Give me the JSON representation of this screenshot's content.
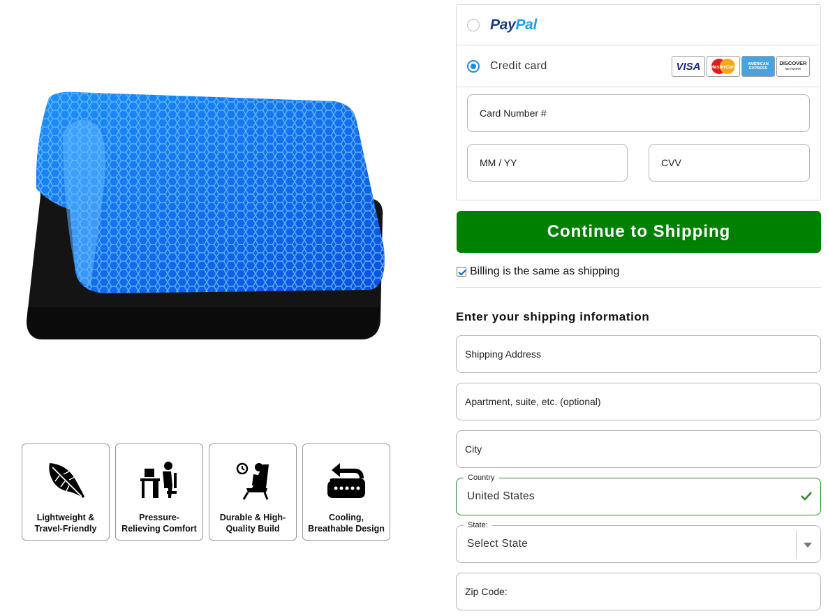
{
  "product": {
    "image_alt": "blue honeycomb gel seat cushion on black foam base",
    "features": [
      {
        "icon": "feather-icon",
        "label": "Lightweight &\nTravel-Friendly"
      },
      {
        "icon": "desk-worker-icon",
        "label": "Pressure-\nRelieving Comfort"
      },
      {
        "icon": "seated-person-clock-icon",
        "label": "Durable & High-\nQuality Build"
      },
      {
        "icon": "airflow-cushion-icon",
        "label": "Cooling,\nBreathable Design"
      }
    ]
  },
  "payment": {
    "paypal": {
      "logo_part1": "Pay",
      "logo_part2": "Pal",
      "selected": false
    },
    "credit_card": {
      "label": "Credit card",
      "selected": true,
      "logos": [
        "VISA",
        "MasterCard",
        "AMERICAN EXPRESS",
        "DISCOVER"
      ],
      "discover_sub": "NETWORK",
      "card_number_placeholder": "Card Number #",
      "expiry_placeholder": "MM / YY",
      "cvv_placeholder": "CVV"
    }
  },
  "actions": {
    "continue_label": "Continue to Shipping"
  },
  "billing": {
    "same_as_shipping_label": "Billing is the same as shipping",
    "checked": true
  },
  "shipping": {
    "title": "Enter your shipping information",
    "address_placeholder": "Shipping Address",
    "apartment_placeholder": "Apartment, suite, etc. (optional)",
    "city_placeholder": "City",
    "country_label": "Country",
    "country_value": "United States",
    "state_label": "State:",
    "state_value": "Select State",
    "zip_placeholder": "Zip Code:"
  },
  "colors": {
    "accent_green": "#008000",
    "radio_blue": "#1e8ae6",
    "valid_green": "#2e8b2e"
  }
}
